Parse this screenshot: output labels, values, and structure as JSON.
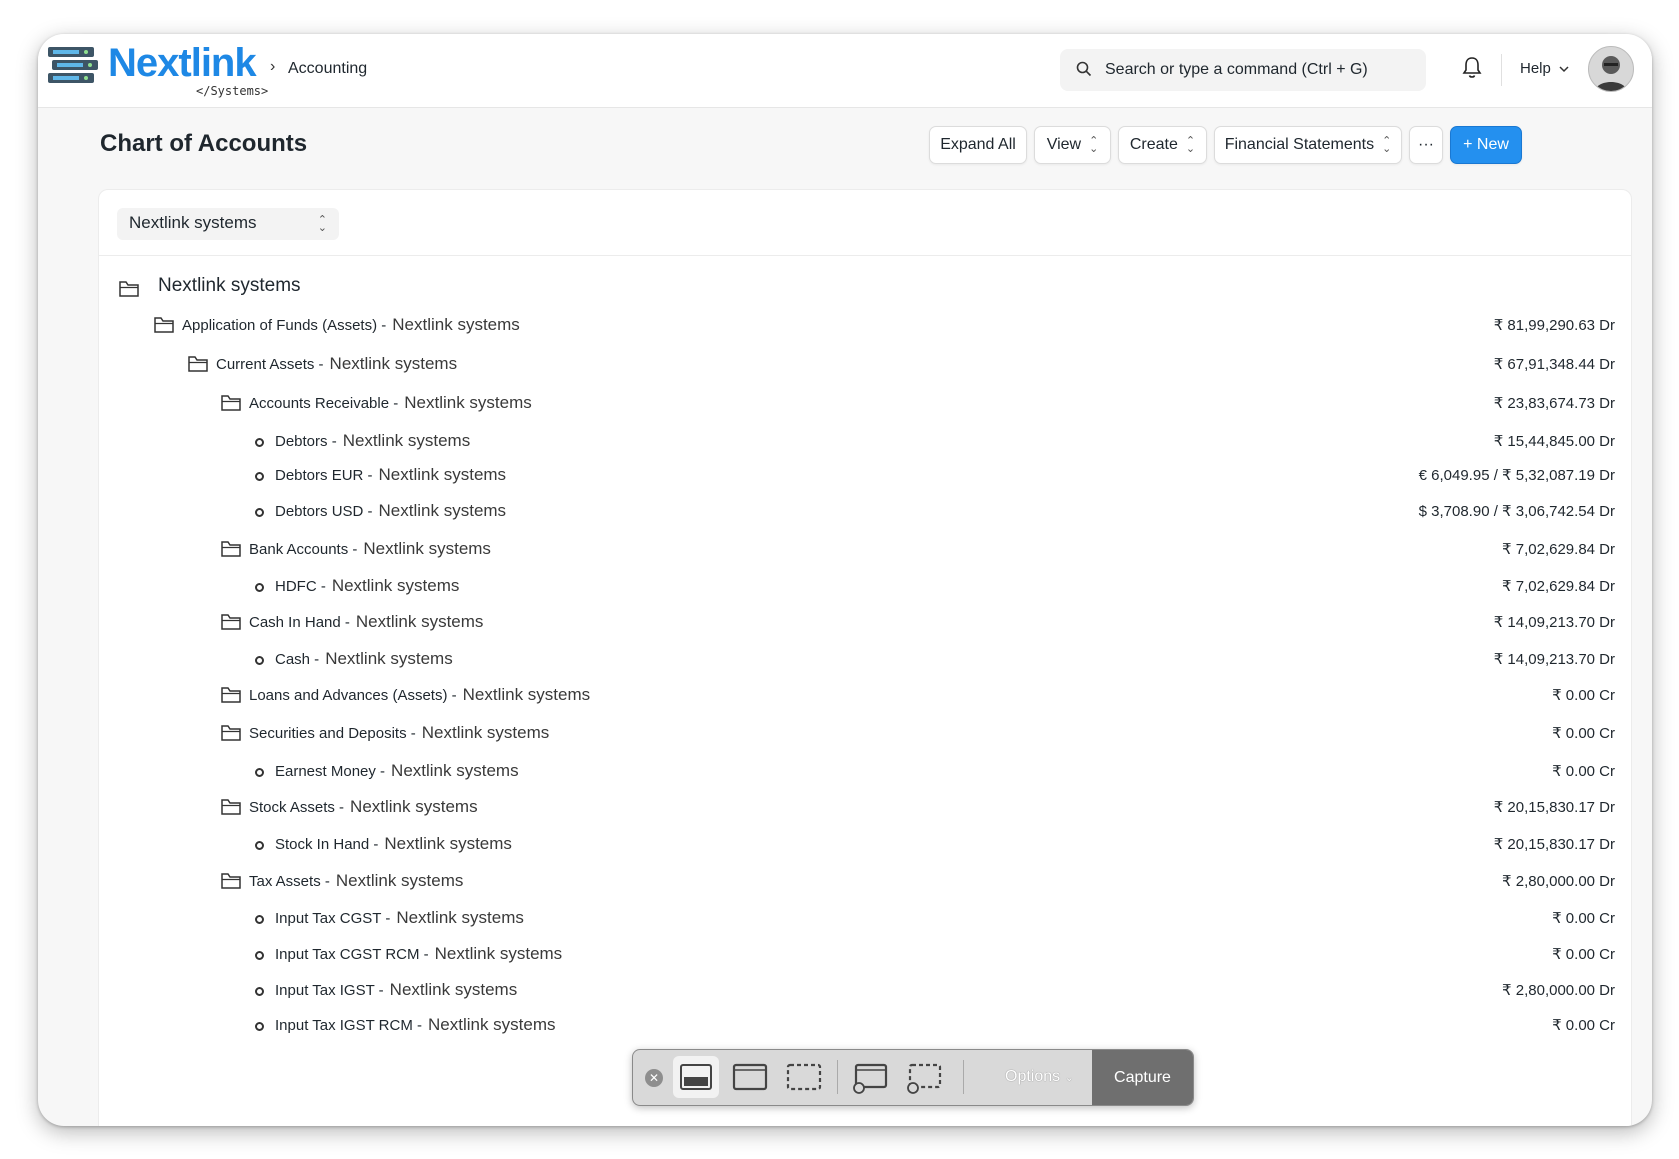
{
  "app": {
    "logo_text": "Nextlink",
    "logo_sub": "</Systems>",
    "breadcrumb": "Accounting",
    "breadcrumb_separator": "›",
    "search_placeholder": "Search or type a command (Ctrl + G)",
    "help_label": "Help",
    "accent_color": "#2490ef"
  },
  "page": {
    "title": "Chart of Accounts",
    "buttons": {
      "expand_all": "Expand All",
      "view": "View",
      "create": "Create",
      "financial_statements": "Financial Statements",
      "more": "···",
      "new": "+ New"
    },
    "company_select": "Nextlink systems"
  },
  "tree": {
    "root": "Nextlink systems",
    "company": "Nextlink systems",
    "rows": [
      {
        "label": "Application of Funds (Assets) -",
        "company": "Nextlink systems",
        "balance": "₹ 81,99,290.63 Dr",
        "type": "group"
      },
      {
        "label": "Current Assets -",
        "company": "Nextlink systems",
        "balance": "₹ 67,91,348.44 Dr",
        "type": "group"
      },
      {
        "label": "Accounts Receivable -",
        "company": "Nextlink systems",
        "balance": "₹ 23,83,674.73 Dr",
        "type": "group"
      },
      {
        "label": "Debtors -",
        "company": "Nextlink systems",
        "balance": "₹ 15,44,845.00 Dr",
        "type": "leaf"
      },
      {
        "label": "Debtors EUR -",
        "company": "Nextlink systems",
        "balance": "€ 6,049.95 / ₹ 5,32,087.19 Dr",
        "type": "leaf"
      },
      {
        "label": "Debtors USD -",
        "company": "Nextlink systems",
        "balance": "$ 3,708.90 / ₹ 3,06,742.54 Dr",
        "type": "leaf"
      },
      {
        "label": "Bank Accounts -",
        "company": "Nextlink systems",
        "balance": "₹ 7,02,629.84 Dr",
        "type": "group"
      },
      {
        "label": "HDFC -",
        "company": "Nextlink systems",
        "balance": "₹ 7,02,629.84 Dr",
        "type": "leaf"
      },
      {
        "label": "Cash In Hand -",
        "company": "Nextlink systems",
        "balance": "₹ 14,09,213.70 Dr",
        "type": "group"
      },
      {
        "label": "Cash -",
        "company": "Nextlink systems",
        "balance": "₹ 14,09,213.70 Dr",
        "type": "leaf"
      },
      {
        "label": "Loans and Advances (Assets) -",
        "company": "Nextlink systems",
        "balance": "₹ 0.00 Cr",
        "type": "group"
      },
      {
        "label": "Securities and Deposits -",
        "company": "Nextlink systems",
        "balance": "₹ 0.00 Cr",
        "type": "group"
      },
      {
        "label": "Earnest Money -",
        "company": "Nextlink systems",
        "balance": "₹ 0.00 Cr",
        "type": "leaf"
      },
      {
        "label": "Stock Assets -",
        "company": "Nextlink systems",
        "balance": "₹ 20,15,830.17 Dr",
        "type": "group"
      },
      {
        "label": "Stock In Hand -",
        "company": "Nextlink systems",
        "balance": "₹ 20,15,830.17 Dr",
        "type": "leaf"
      },
      {
        "label": "Tax Assets -",
        "company": "Nextlink systems",
        "balance": "₹ 2,80,000.00 Dr",
        "type": "group"
      },
      {
        "label": "Input Tax CGST -",
        "company": "Nextlink systems",
        "balance": "₹ 0.00 Cr",
        "type": "leaf"
      },
      {
        "label": "Input Tax CGST RCM -",
        "company": "Nextlink systems",
        "balance": "₹ 0.00 Cr",
        "type": "leaf"
      },
      {
        "label": "Input Tax IGST -",
        "company": "Nextlink systems",
        "balance": "₹ 2,80,000.00 Dr",
        "type": "leaf"
      },
      {
        "label": "Input Tax IGST RCM -",
        "company": "Nextlink systems",
        "balance": "₹ 0.00 Cr",
        "type": "leaf"
      }
    ]
  },
  "capture_toolbar": {
    "options_label": "Options",
    "capture_label": "Capture"
  }
}
